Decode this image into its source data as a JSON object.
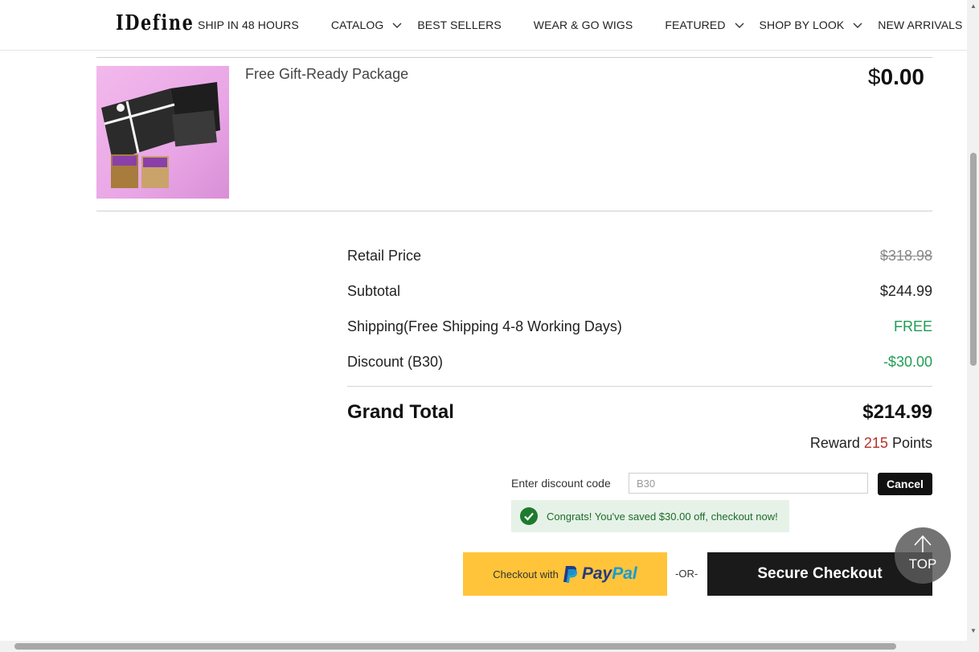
{
  "header": {
    "logo": "IDefine",
    "nav": [
      {
        "label": "SHIP IN 48 HOURS",
        "dropdown": false
      },
      {
        "label": "CATALOG",
        "dropdown": true
      },
      {
        "label": "BEST SELLERS",
        "dropdown": false
      },
      {
        "label": "WEAR & GO WIGS",
        "dropdown": false
      },
      {
        "label": "FEATURED",
        "dropdown": true
      },
      {
        "label": "SHOP BY LOOK",
        "dropdown": true
      },
      {
        "label": "NEW ARRIVALS",
        "dropdown": false
      }
    ]
  },
  "product": {
    "name": "Free Gift-Ready Package",
    "price_symbol": "$",
    "price_value": "0.00",
    "image_icon": "gift-package-image"
  },
  "summary": {
    "retail_label": "Retail Price",
    "retail_value": "$318.98",
    "subtotal_label": "Subtotal",
    "subtotal_value": "$244.99",
    "shipping_label": "Shipping(Free Shipping 4-8 Working Days)",
    "shipping_value": "FREE",
    "discount_label": "Discount (B30)",
    "discount_value": "-$30.00",
    "grand_label": "Grand Total",
    "grand_value": "$214.99",
    "reward_prefix": "Reward",
    "reward_points": "215",
    "reward_suffix": "Points"
  },
  "discount": {
    "label": "Enter discount code",
    "value": "B30",
    "cancel_label": "Cancel",
    "success_message": "Congrats! You've saved $30.00 off, checkout now!"
  },
  "checkout": {
    "paypal_prefix": "Checkout with",
    "paypal_word_a": "Pay",
    "paypal_word_b": "Pal",
    "or_label": "-OR-",
    "secure_label": "Secure Checkout"
  },
  "top_button": {
    "label": "TOP"
  },
  "colors": {
    "accent_green": "#1f9d55",
    "points_red": "#b5322c",
    "paypal_yellow": "#ffc439",
    "dark_button": "#1a1a1a"
  }
}
